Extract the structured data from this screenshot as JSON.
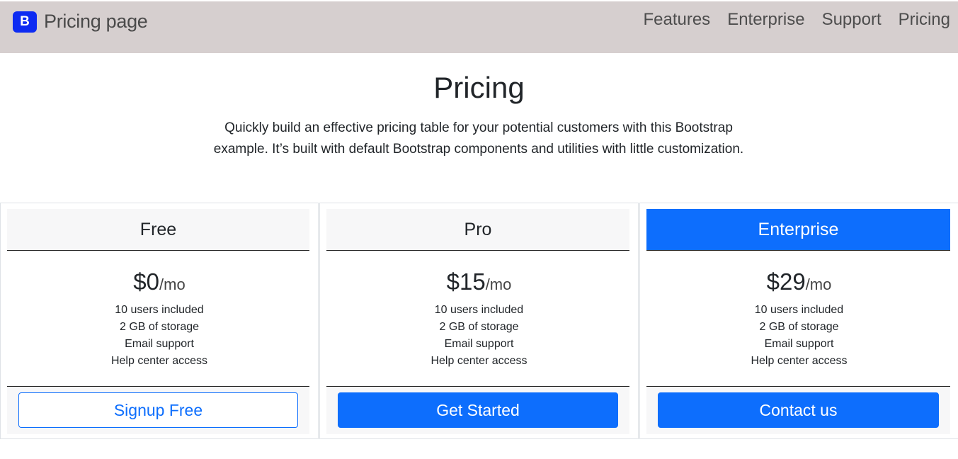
{
  "navbar": {
    "brand_icon_text": "B",
    "brand_title": "Pricing page",
    "links": [
      "Features",
      "Enterprise",
      "Support",
      "Pricing"
    ]
  },
  "hero": {
    "title": "Pricing",
    "lead": "Quickly build an effective pricing table for your potential customers with this Bootstrap example. It’s built with default Bootstrap components and utilities with little customization."
  },
  "plans": [
    {
      "name": "Free",
      "price": "$0",
      "period": "/mo",
      "features": [
        "10 users included",
        "2 GB of storage",
        "Email support",
        "Help center access"
      ],
      "button_label": "Signup Free"
    },
    {
      "name": "Pro",
      "price": "$15",
      "period": "/mo",
      "features": [
        "10 users included",
        "2 GB of storage",
        "Email support",
        "Help center access"
      ],
      "button_label": "Get Started"
    },
    {
      "name": "Enterprise",
      "price": "$29",
      "period": "/mo",
      "features": [
        "10 users included",
        "2 GB of storage",
        "Email support",
        "Help center access"
      ],
      "button_label": "Contact us"
    }
  ],
  "colors": {
    "navbar_bg": "#d6cfcf",
    "brand_icon_bg": "#0d2bf2",
    "primary": "#0d6efd",
    "card_muted_bg": "#f7f7f8"
  }
}
